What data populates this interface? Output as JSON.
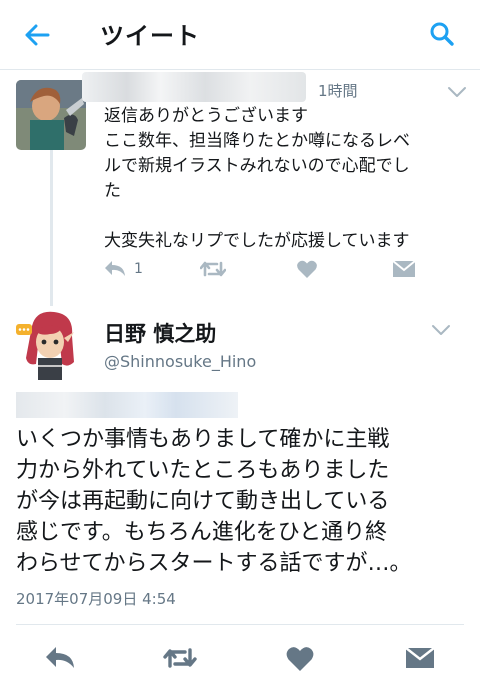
{
  "header": {
    "title": "ツイート",
    "back_icon": "arrow-left-icon",
    "search_icon": "search-icon",
    "accent_color": "#1da1f2"
  },
  "reply": {
    "time": "1時間",
    "text_lines": [
      "返信ありがとうございます",
      "ここ数年、担当降りたとか噂になるレベ",
      "ルで新規イラストみれないので心配でし",
      "た",
      "",
      "大変失礼なリプでしたが応援しています"
    ],
    "reply_count": "1",
    "actions": [
      "reply-icon",
      "retweet-icon",
      "heart-icon",
      "direct-message-icon"
    ]
  },
  "main_tweet": {
    "display_name": "日野 慎之助",
    "handle": "@Shinnosuke_Hino",
    "text_lines": [
      "いくつか事情もありまして確かに主戦",
      "力から外れていたところもありました",
      "が今は再起動に向けて動き出している",
      "感じです。もちろん進化をひと通り終",
      "わらせてからスタートする話ですが…。"
    ],
    "timestamp": "2017年07月09日 4:54",
    "actions": [
      "reply-icon",
      "retweet-icon",
      "heart-icon",
      "direct-message-icon"
    ]
  },
  "colors": {
    "text_primary": "#14171a",
    "text_secondary": "#657786",
    "icon_gray": "#8899a6",
    "divider": "#e1e8ed"
  }
}
